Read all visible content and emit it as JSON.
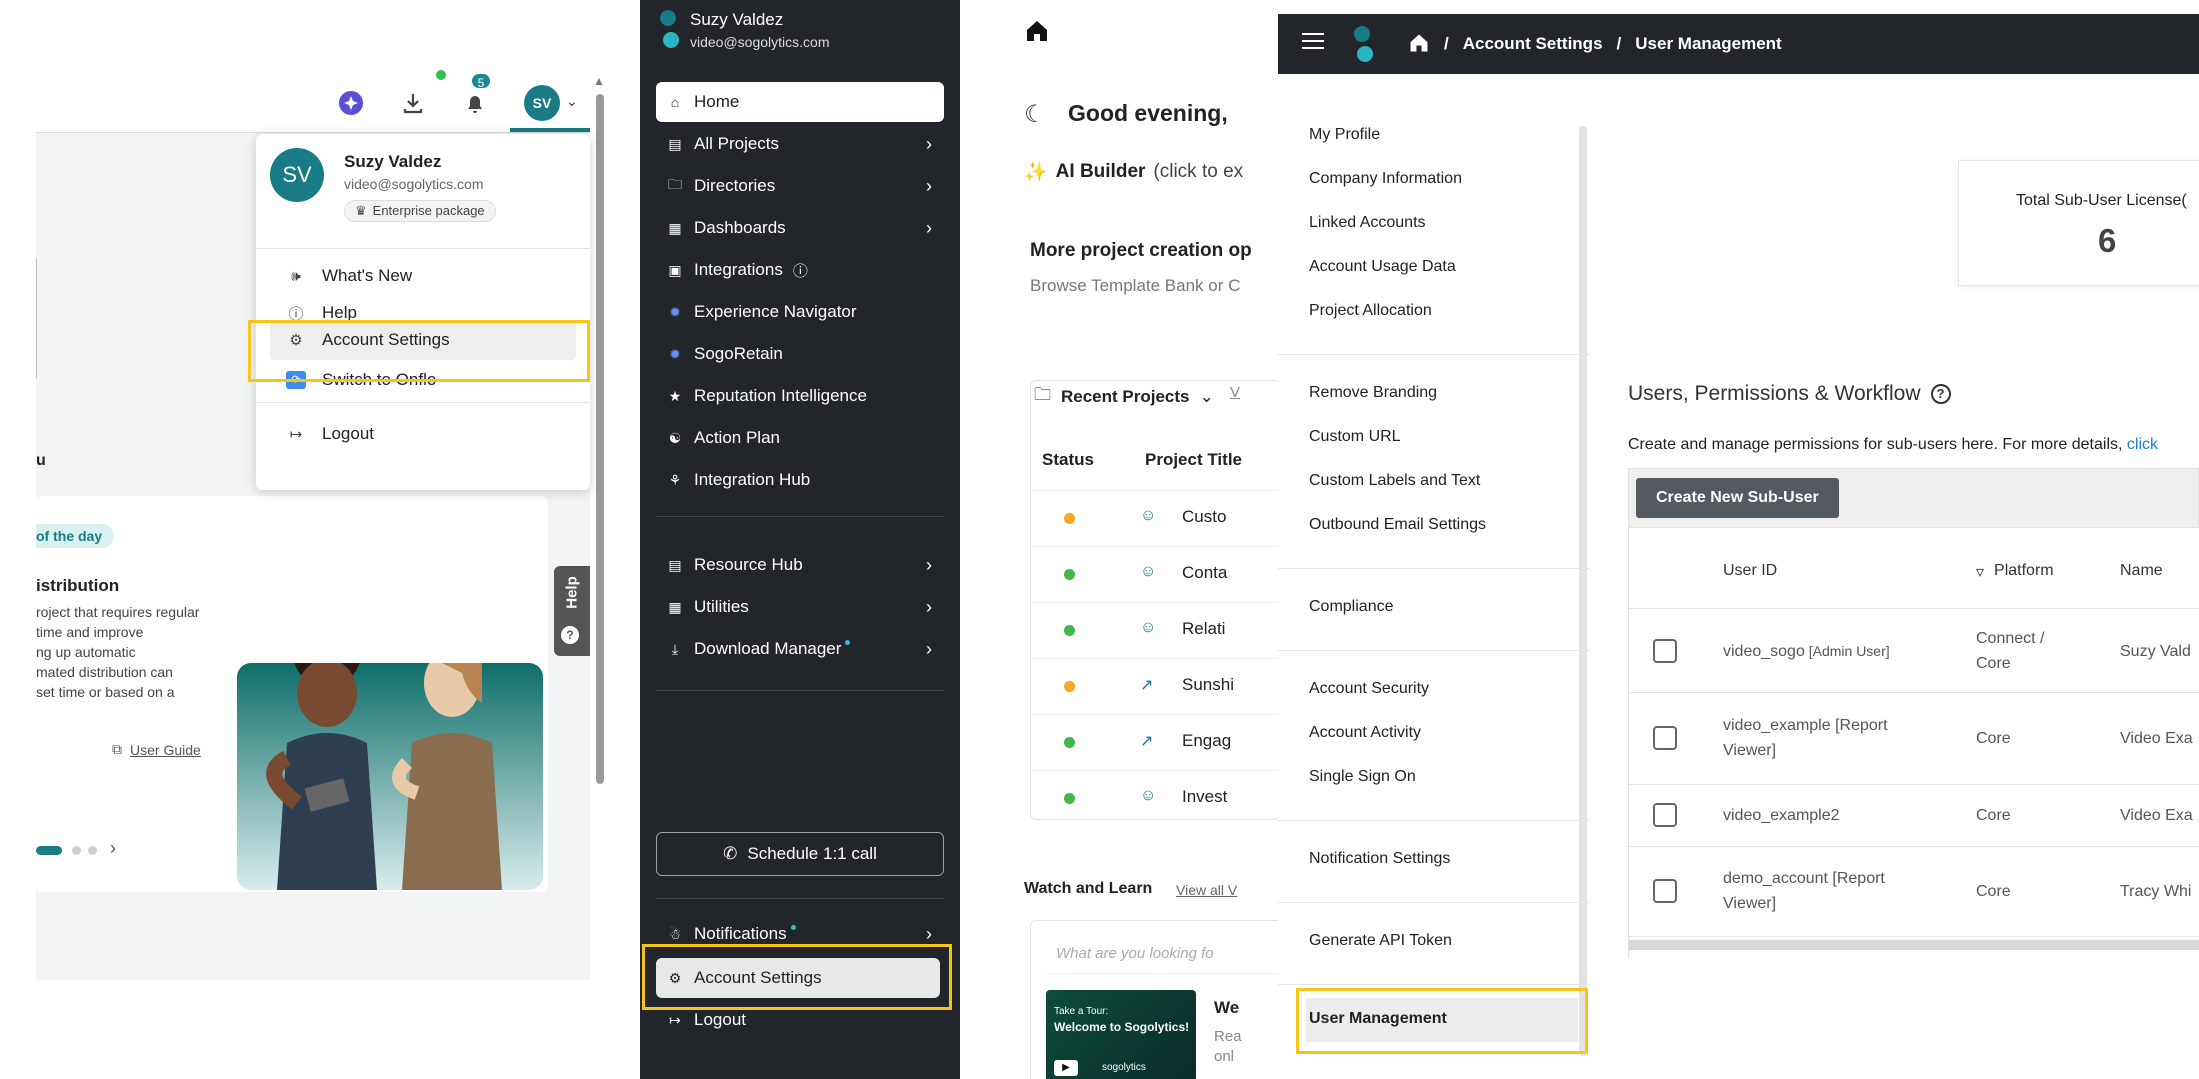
{
  "p1": {
    "badge_count": "5",
    "avatar_initials": "SV",
    "menu": {
      "avatar_initials": "SV",
      "name": "Suzy Valdez",
      "email": "video@sogolytics.com",
      "package": "Enterprise package",
      "items": [
        "What's New",
        "Help",
        "Account Settings",
        "Switch to Onflo",
        "Logout"
      ]
    },
    "card": {
      "tag": "of the day",
      "title": "istribution",
      "lines": [
        "roject that requires regular",
        " time and improve",
        "ng up automatic",
        "mated distribution can",
        "set time or based on a"
      ],
      "guide_link": "User Guide"
    },
    "help_tab": "Help",
    "side_letter": "u"
  },
  "p2": {
    "user_name": "Suzy Valdez",
    "user_email": "video@sogolytics.com",
    "nav": [
      "Home",
      "All Projects",
      "Directories",
      "Dashboards",
      "Integrations",
      "Experience Navigator",
      "SogoRetain",
      "Reputation Intelligence",
      "Action Plan",
      "Integration Hub"
    ],
    "nav2": [
      "Resource Hub",
      "Utilities",
      "Download Manager"
    ],
    "schedule_call": "Schedule 1:1 call",
    "bottom": [
      "Notifications",
      "Account Settings",
      "Logout"
    ]
  },
  "p3": {
    "greeting": "Good evening,",
    "ai_builder_label": "AI Builder",
    "ai_builder_hint": "(click to ex",
    "more_title": "More project creation op",
    "more_sub": "Browse Template Bank or C",
    "recent_projects": "Recent Projects",
    "view_link": "V",
    "col_status": "Status",
    "col_title": "Project Title",
    "projects": [
      "Custo",
      "Conta",
      "Relati",
      "Sunshi",
      "Engag",
      "Invest"
    ],
    "watch_learn": "Watch and Learn",
    "view_all": "View all V",
    "search_placeholder": "What are you looking fo",
    "video_title": "We",
    "video_sub1": "Rea",
    "video_sub2": "onl",
    "thumb_line1": "Take a Tour:",
    "thumb_line2": "Welcome to Sogolytics!",
    "thumb_brand": "sogolytics"
  },
  "p4": {
    "breadcrumb": [
      "Account Settings",
      "User Management"
    ],
    "menu_groups": [
      [
        "My Profile",
        "Company Information",
        "Linked Accounts",
        "Account Usage Data",
        "Project Allocation"
      ],
      [
        "Remove Branding",
        "Custom URL",
        "Custom Labels and Text",
        "Outbound Email Settings"
      ],
      [
        "Compliance"
      ],
      [
        "Account Security",
        "Account Activity",
        "Single Sign On"
      ],
      [
        "Notification Settings"
      ],
      [
        "Generate API Token"
      ],
      [
        "User Management"
      ]
    ],
    "license_label": "Total Sub-User License(",
    "license_value": "6",
    "section_title": "Users, Permissions & Workflow",
    "section_desc": "Create and manage permissions for sub-users here. For more details,",
    "section_link": "click",
    "create_button": "Create New Sub-User",
    "columns": [
      "User ID",
      "Platform",
      "Name"
    ],
    "rows": [
      {
        "id": "video_sogo",
        "tag": "[Admin User]",
        "platform": [
          "Connect /",
          "Core"
        ],
        "name": "Suzy Vald"
      },
      {
        "id": "video_example [Report",
        "tag": "Viewer]",
        "platform": [
          "Core"
        ],
        "name": "Video Exa"
      },
      {
        "id": "video_example2",
        "tag": "",
        "platform": [
          "Core"
        ],
        "name": "Video Exa"
      },
      {
        "id": "demo_account [Report",
        "tag": "Viewer]",
        "platform": [
          "Core"
        ],
        "name": "Tracy Whi"
      }
    ]
  },
  "colors": {
    "highlight": "#f5c518",
    "teal": "#187b85",
    "dark": "#22262b",
    "green": "#44b54a",
    "orange": "#f5a623"
  }
}
